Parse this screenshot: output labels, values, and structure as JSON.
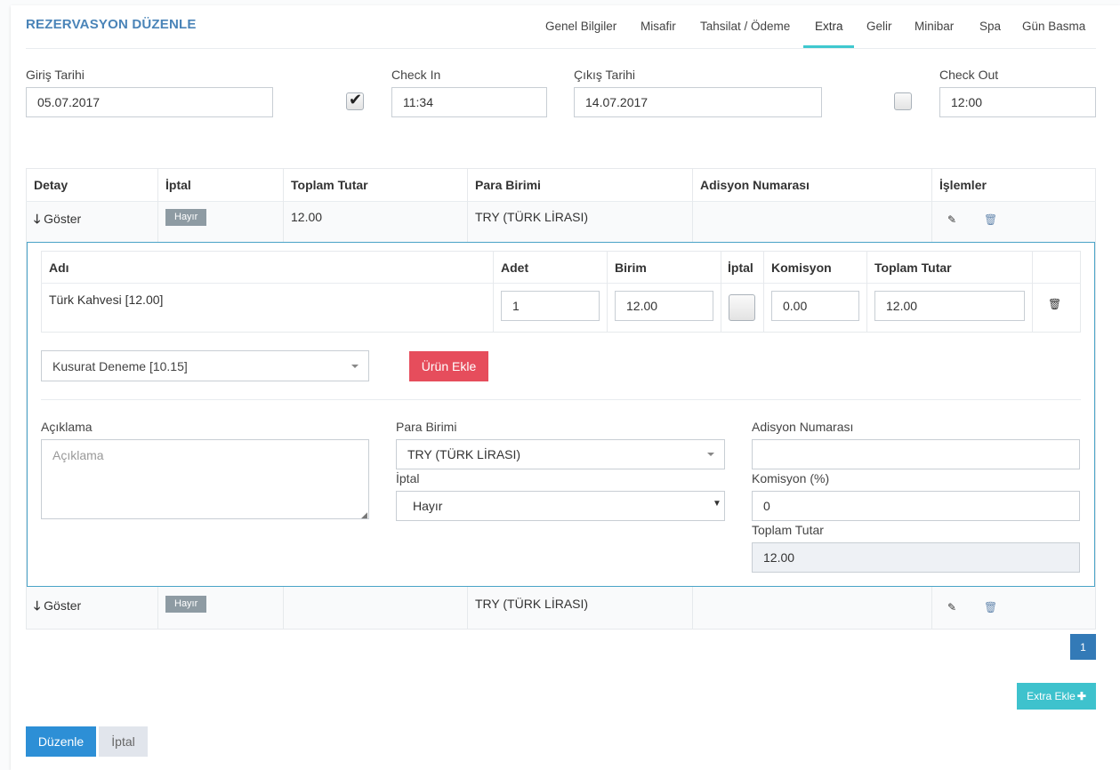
{
  "header": {
    "title": "REZERVASYON DÜZENLE",
    "tabs": [
      "Genel Bilgiler",
      "Misafir",
      "Tahsilat / Ödeme",
      "Extra",
      "Gelir",
      "Minibar",
      "Spa",
      "Gün Basma"
    ],
    "active_tab": "Extra"
  },
  "dates": {
    "giris_label": "Giriş Tarihi",
    "giris_value": "05.07.2017",
    "checkin_label": "Check In",
    "checkin_value": "11:34",
    "checkin_checked": true,
    "cikis_label": "Çıkış Tarihi",
    "cikis_value": "14.07.2017",
    "checkout_label": "Check Out",
    "checkout_value": "12:00",
    "checkout_checked": false
  },
  "extras_table": {
    "headers": [
      "Detay",
      "İptal",
      "Toplam Tutar",
      "Para Birimi",
      "Adisyon Numarası",
      "İşlemler"
    ],
    "rows": [
      {
        "detay": "Göster",
        "iptal": "Hayır",
        "toplam": "12.00",
        "para_birimi": "TRY (TÜRK LİRASI)",
        "adisyon": ""
      },
      {
        "detay": "Göster",
        "iptal": "Hayır",
        "toplam": "",
        "para_birimi": "TRY (TÜRK LİRASI)",
        "adisyon": ""
      }
    ]
  },
  "detail": {
    "items_headers": [
      "Adı",
      "Adet",
      "Birim",
      "İptal",
      "Komisyon",
      "Toplam Tutar"
    ],
    "items": [
      {
        "name": "Türk Kahvesi [12.00]",
        "adet": "1",
        "birim": "12.00",
        "iptal": false,
        "komisyon": "0.00",
        "toplam": "12.00"
      }
    ],
    "product_select": "Kusurat Deneme [10.15]",
    "add_product_label": "Ürün Ekle",
    "aciklama_label": "Açıklama",
    "aciklama_placeholder": "Açıklama",
    "para_birimi_label": "Para Birimi",
    "para_birimi_value": "TRY (TÜRK LİRASI)",
    "iptal_label": "İptal",
    "iptal_value": "Hayır",
    "adisyon_label": "Adisyon Numarası",
    "adisyon_value": "",
    "komisyon_label": "Komisyon (%)",
    "komisyon_value": "0",
    "toplam_label": "Toplam Tutar",
    "toplam_value": "12.00"
  },
  "pagination": {
    "current": "1"
  },
  "actions": {
    "extra_ekle": "Extra Ekle",
    "duzenle": "Düzenle",
    "iptal": "İptal"
  },
  "icons": {
    "expand": "arrow-down-icon",
    "edit": "pencil-icon",
    "delete": "trash-icon",
    "add": "plus-icon"
  }
}
